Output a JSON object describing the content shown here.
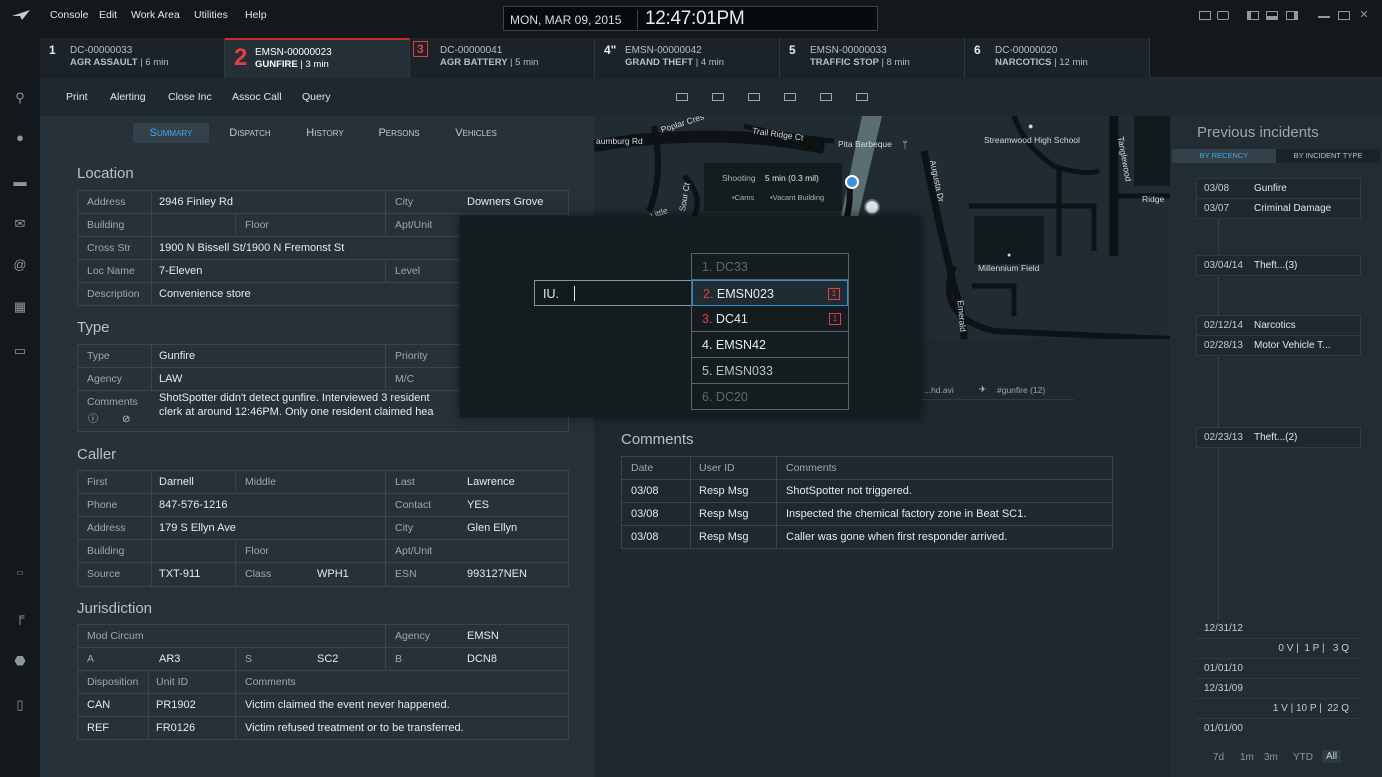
{
  "menu": {
    "items": [
      "Console",
      "Edit",
      "Work Area",
      "Utilities",
      "Help"
    ]
  },
  "clock": {
    "date": "MON, MAR 09, 2015",
    "time": "12:47:01PM"
  },
  "incident_tabs": [
    {
      "num": "1",
      "id": "DC-00000033",
      "type": "AGR ASSAULT",
      "time": "6 min"
    },
    {
      "num": "2",
      "id": "EMSN-00000023",
      "type": "GUNFIRE",
      "time": "3 min"
    },
    {
      "num": "3",
      "id": "DC-00000041",
      "type": "AGR BATTERY",
      "time": "5 min"
    },
    {
      "num": "4\"",
      "id": "EMSN-00000042",
      "type": "GRAND THEFT",
      "time": "4 min"
    },
    {
      "num": "5",
      "id": "EMSN-00000033",
      "type": "TRAFFIC STOP",
      "time": "8 min"
    },
    {
      "num": "6",
      "id": "DC-00000020",
      "type": "NARCOTICS",
      "time": "12 min"
    }
  ],
  "toolbar": {
    "print": "Print",
    "alerting": "Alerting",
    "close_inc": "Close Inc",
    "assoc_call": "Assoc Call",
    "query": "Query"
  },
  "subtabs": [
    "Summary",
    "Dispatch",
    "History",
    "Persons",
    "Vehicles"
  ],
  "location": {
    "title": "Location",
    "address_label": "Address",
    "address": "2946 Finley Rd",
    "city_label": "City",
    "city": "Downers Grove",
    "building_label": "Building",
    "floor_label": "Floor",
    "apt_label": "Apt/Unit",
    "cross_label": "Cross Str",
    "cross": "1900 N Bissell St/1900 N Fremonst St",
    "locname_label": "Loc Name",
    "locname": "7-Eleven",
    "level_label": "Level",
    "desc_label": "Description",
    "desc": "Convenience store"
  },
  "type": {
    "title": "Type",
    "type_label": "Type",
    "type": "Gunfire",
    "priority_label": "Priority",
    "agency_label": "Agency",
    "agency": "LAW",
    "mc_label": "M/C",
    "comments_label": "Comments",
    "comments_line1": "ShotSpotter didn't detect gunfire. Interviewed 3 resident",
    "comments_line2": "clerk at around 12:46PM. Only one resident claimed hea"
  },
  "caller": {
    "title": "Caller",
    "first_label": "First",
    "first": "Darnell",
    "middle_label": "Middle",
    "last_label": "Last",
    "last": "Lawrence",
    "phone_label": "Phone",
    "phone": "847-576-1216",
    "contact_label": "Contact",
    "contact": "YES",
    "address_label": "Address",
    "address": "179 S Ellyn Ave",
    "city_label": "City",
    "city": "Glen Ellyn",
    "building_label": "Building",
    "floor_label": "Floor",
    "apt_label": "Apt/Unit",
    "source_label": "Source",
    "source": "TXT-911",
    "class_label": "Class",
    "class": "WPH1",
    "esn_label": "ESN",
    "esn": "993127NEN"
  },
  "jurisdiction": {
    "title": "Jurisdiction",
    "modcirc_label": "Mod Circum",
    "agency_label": "Agency",
    "agency": "EMSN",
    "a_label": "A",
    "a": "AR3",
    "s_label": "S",
    "s": "SC2",
    "b_label": "B",
    "b": "DCN8",
    "disp_label": "Disposition",
    "unit_label": "Unit ID",
    "comments_label": "Comments",
    "rows": [
      {
        "disp": "CAN",
        "unit": "PR1902",
        "comment": "Victim claimed the event never happened."
      },
      {
        "disp": "REF",
        "unit": "FR0126",
        "comment": "Victim refused treatment or to be transferred."
      }
    ]
  },
  "map": {
    "labels": {
      "poplar": "Poplar Cres",
      "schaumburg": "aumburg Rd",
      "trail": "Trail Ridge Ct",
      "pita": "Pita Barbeque",
      "school": "Streamwood High School",
      "tangle": "Tanglewood",
      "ridge": "Ridge",
      "augusta": "Augusta Dr",
      "sour": "Sour Ct",
      "little": "Little",
      "millennium": "Millennium Field",
      "emerald": "Emerald"
    },
    "popup": {
      "title": "Shooting",
      "eta": "5 min (0.3 mil)",
      "tag1": "•Cams",
      "tag2": "•Vacant Building"
    }
  },
  "media": {
    "video": "...hd.avi",
    "tweet": "#gunfire (12)"
  },
  "comments": {
    "title": "Comments",
    "headers": [
      "Date",
      "User ID",
      "Comments"
    ],
    "rows": [
      {
        "date": "03/08",
        "user": "Resp Msg",
        "text": "ShotSpotter not triggered."
      },
      {
        "date": "03/08",
        "user": "Resp Msg",
        "text": "Inspected the chemical factory zone in Beat SC1."
      },
      {
        "date": "03/08",
        "user": "Resp Msg",
        "text": "Caller was gone when first responder arrived."
      }
    ]
  },
  "previous": {
    "title": "Previous incidents",
    "tab_recency": "BY RECENCY",
    "tab_type": "BY INCIDENT TYPE",
    "groups": [
      [
        {
          "date": "03/08",
          "name": "Gunfire"
        },
        {
          "date": "03/07",
          "name": "Criminal Damage"
        }
      ],
      [
        {
          "date": "03/04/14",
          "name": "Theft...(3)"
        }
      ],
      [
        {
          "date": "02/12/14",
          "name": "Narcotics"
        },
        {
          "date": "02/28/13",
          "name": "Motor Vehicle T..."
        }
      ],
      [
        {
          "date": "02/23/13",
          "name": "Theft...(2)"
        }
      ]
    ],
    "timeline": [
      "12/31/12",
      "0 V |  1 P |   3 Q",
      "01/01/10",
      "12/31/09",
      "1 V | 10 P |  22 Q",
      "01/01/00"
    ],
    "filters": [
      "7d",
      "1m",
      "3m",
      "YTD",
      "All"
    ]
  },
  "command": {
    "input": "IU.",
    "options": [
      {
        "n": "1.",
        "code": "DC33"
      },
      {
        "n": "2.",
        "code": "EMSN023",
        "badge": "1"
      },
      {
        "n": "3.",
        "code": "DC41",
        "badge": "1"
      },
      {
        "n": "4.",
        "code": "EMSN42"
      },
      {
        "n": "5.",
        "code": "EMSN033"
      },
      {
        "n": "6.",
        "code": "DC20"
      }
    ]
  },
  "colors": {
    "accent": "#4aa3e6",
    "alert": "#e04040",
    "bg": "#1b2329"
  },
  "icons": [
    "search-icon",
    "user-add-icon",
    "car-icon",
    "mail-icon",
    "at-icon",
    "map-icon",
    "chat-icon",
    "plate-icon",
    "gun-icon",
    "stop-icon",
    "clipboard-icon"
  ]
}
